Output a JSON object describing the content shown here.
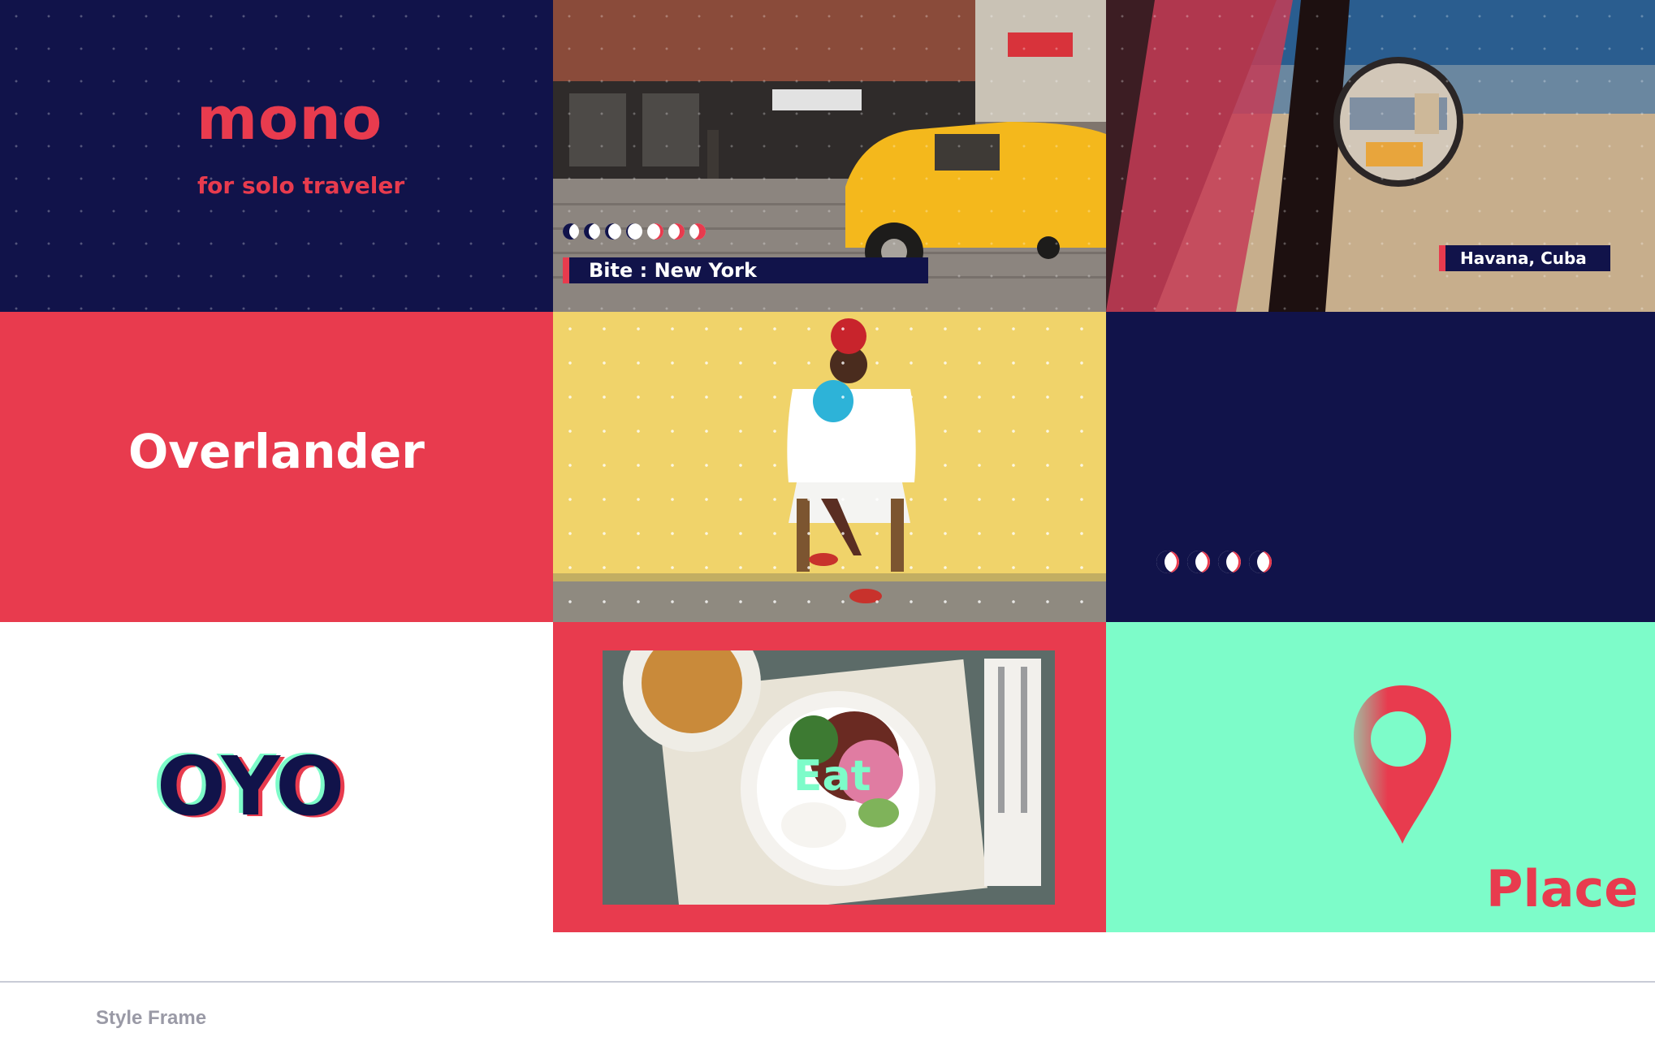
{
  "tiles": {
    "mono": {
      "title": "mono",
      "subtitle": "for solo traveler"
    },
    "new_york": {
      "caption": "Bite : New York"
    },
    "havana": {
      "caption": "Havana, Cuba"
    },
    "overlander": {
      "title": "Overlander"
    },
    "oyo": {
      "title": "OYO"
    },
    "eat": {
      "title": "Eat"
    },
    "place": {
      "title": "Place"
    }
  },
  "footer": {
    "label": "Style Frame"
  },
  "colors": {
    "navy": "#11134a",
    "red": "#e83b4e",
    "mint": "#7dfcc9",
    "white": "#ffffff",
    "taxi_yellow": "#f4b81c",
    "wall_yellow": "#f0d36a"
  },
  "icons": [
    "moon-phase-icon",
    "location-pin-icon"
  ]
}
